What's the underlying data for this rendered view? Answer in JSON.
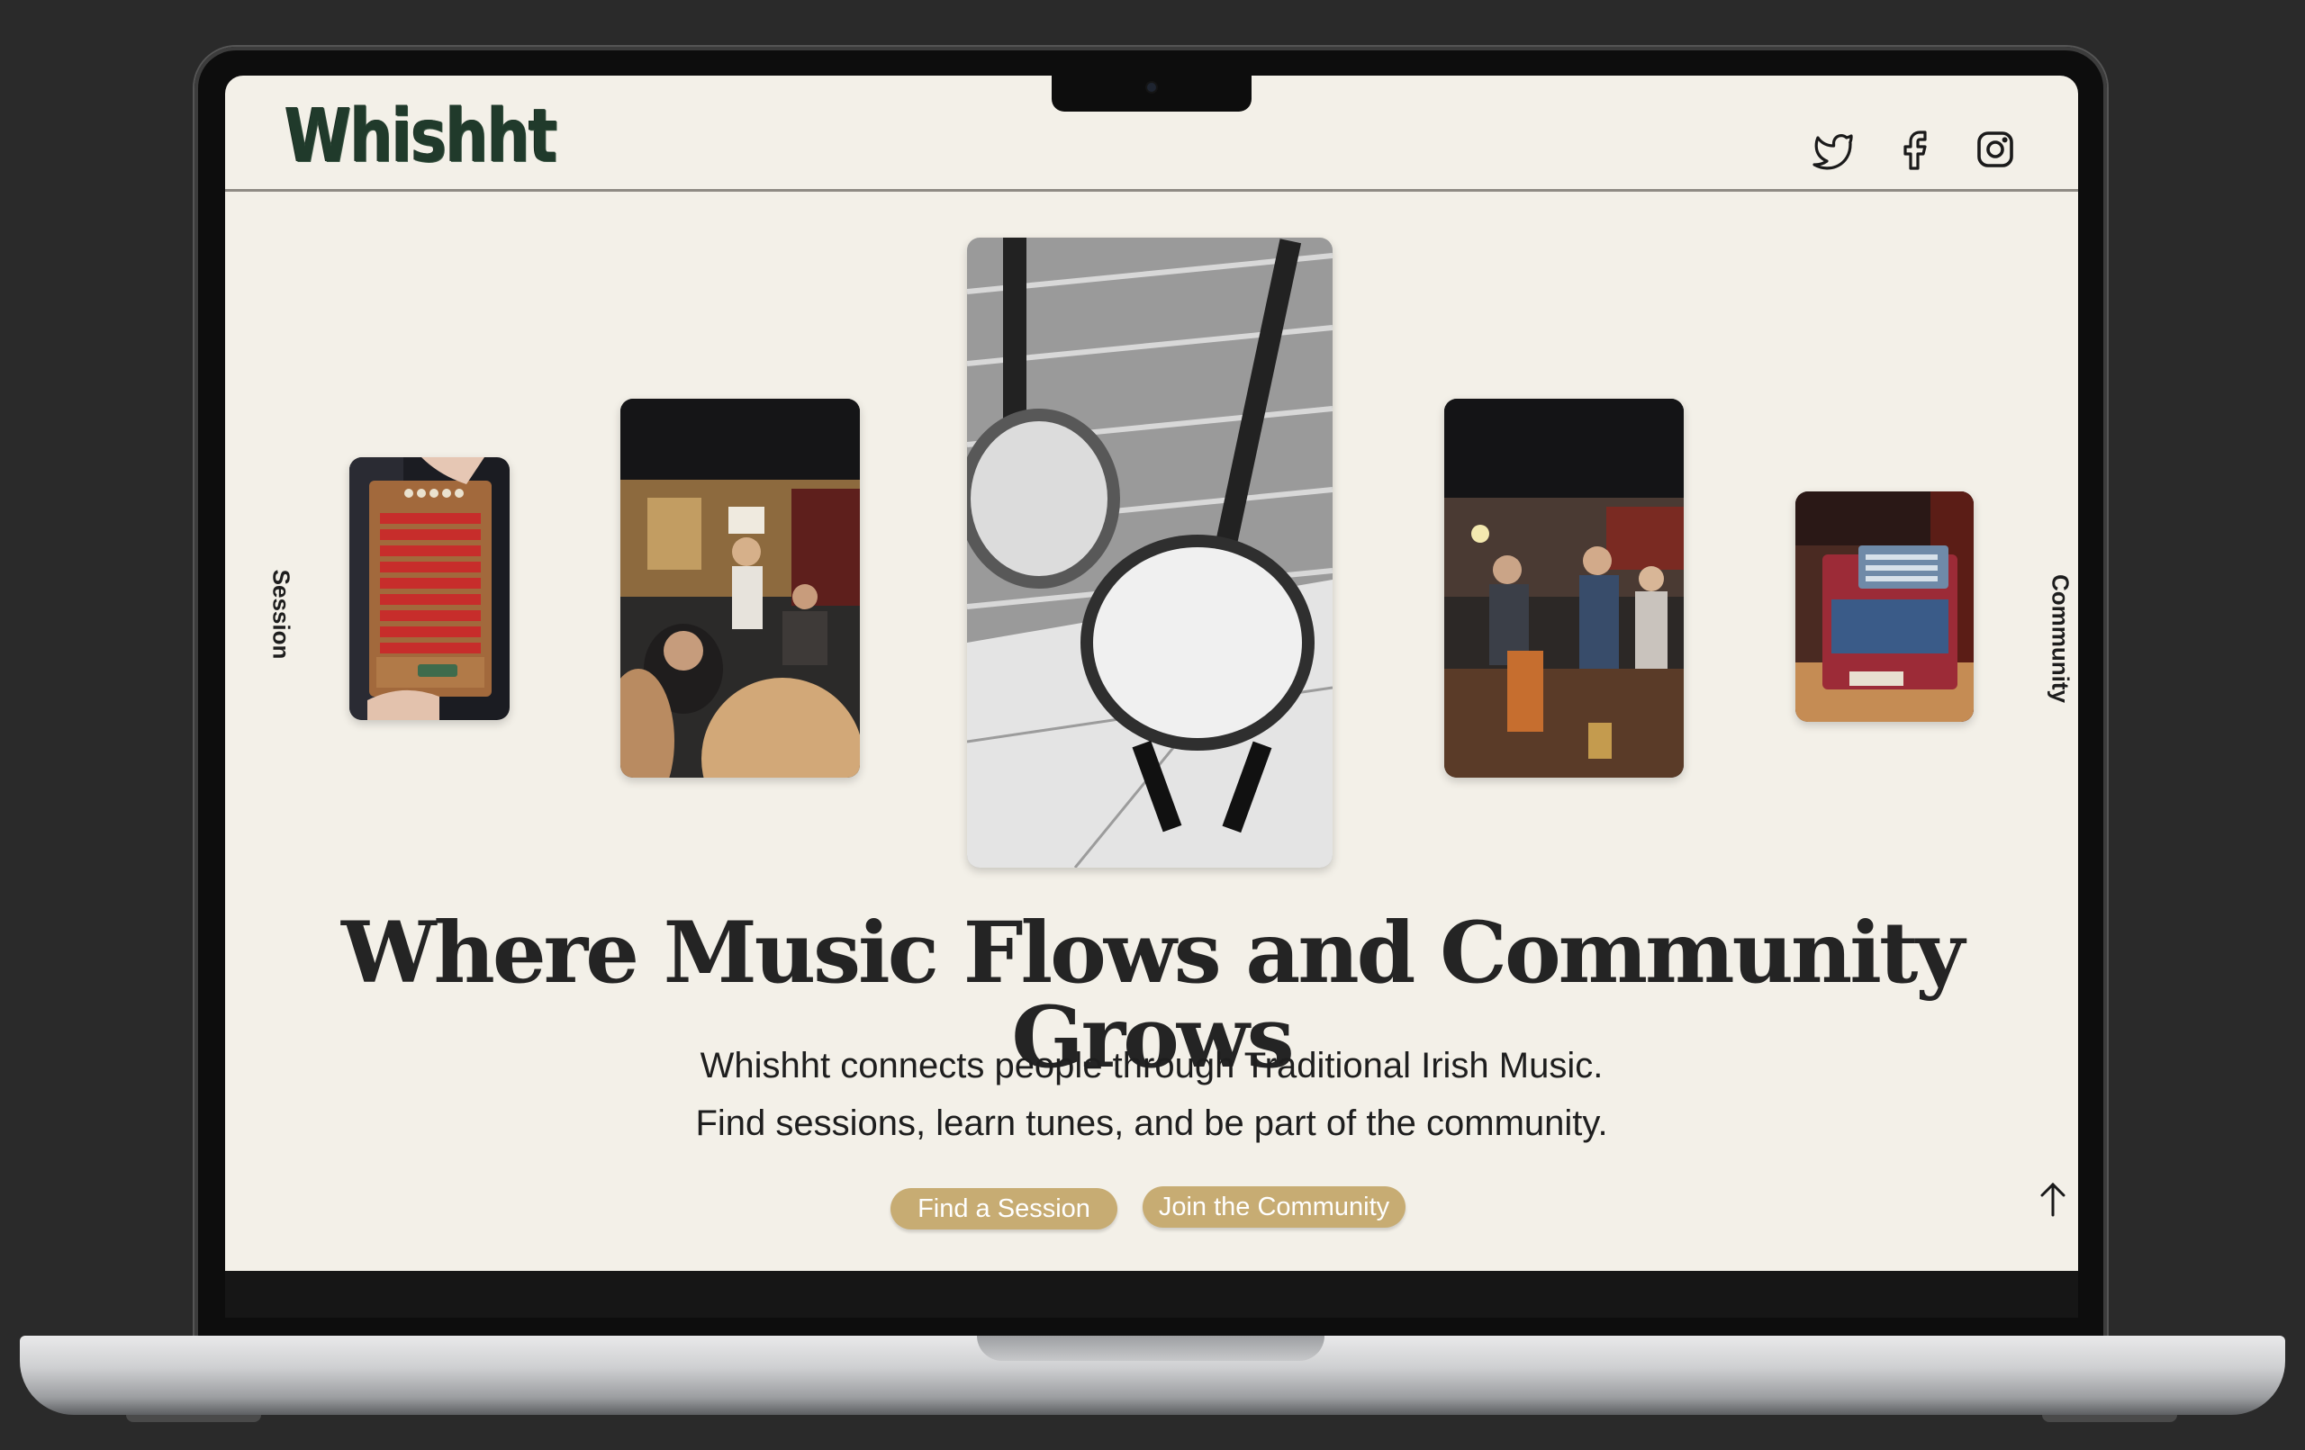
{
  "header": {
    "logo": "Whishht",
    "social": [
      {
        "name": "twitter-icon"
      },
      {
        "name": "facebook-icon"
      },
      {
        "name": "instagram-icon"
      }
    ]
  },
  "side_nav": {
    "left": "Session",
    "right": "Community"
  },
  "gallery": [
    {
      "subject": "red concertina held in hands"
    },
    {
      "subject": "pub session with musicians"
    },
    {
      "subject": "two banjos on stands, black and white"
    },
    {
      "subject": "people gathered in a pub"
    },
    {
      "subject": "red button accordion on a table"
    }
  ],
  "hero": {
    "title": "Where Music Flows and Community Grows",
    "line1": "Whishht connects people through Traditional Irish Music.",
    "line2": "Find sessions, learn tunes, and be part of the community.",
    "buttons": {
      "find_session": "Find a Session",
      "join_community": "Join the Community"
    }
  },
  "colors": {
    "background": "#f3f0e8",
    "logo": "#203a2b",
    "button": "#c7ac73"
  }
}
